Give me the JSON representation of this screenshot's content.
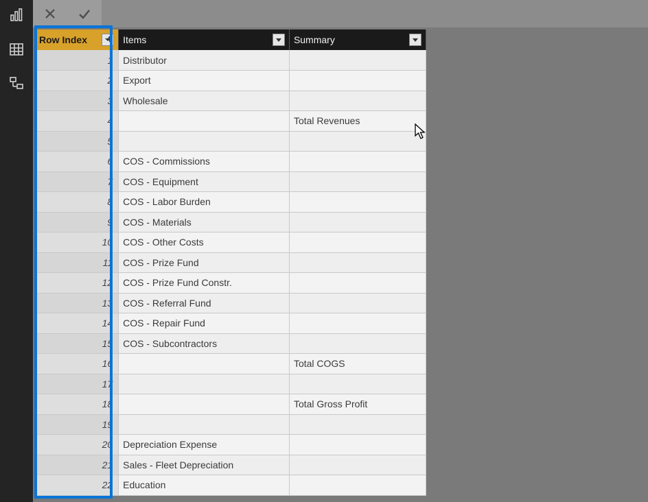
{
  "nav": {
    "report_icon": "report-view-icon",
    "data_icon": "data-view-icon",
    "model_icon": "model-view-icon"
  },
  "formulaBar": {
    "cancel": "✕",
    "accept": "✓"
  },
  "table": {
    "columns": {
      "rowIndex": "Row Index",
      "items": "Items",
      "summary": "Summary"
    },
    "rows": [
      {
        "idx": "1",
        "items": "Distributor",
        "summary": ""
      },
      {
        "idx": "2",
        "items": "Export",
        "summary": ""
      },
      {
        "idx": "3",
        "items": "Wholesale",
        "summary": ""
      },
      {
        "idx": "4",
        "items": "",
        "summary": "Total Revenues"
      },
      {
        "idx": "5",
        "items": "",
        "summary": ""
      },
      {
        "idx": "6",
        "items": "COS - Commissions",
        "summary": ""
      },
      {
        "idx": "7",
        "items": "COS - Equipment",
        "summary": ""
      },
      {
        "idx": "8",
        "items": "COS - Labor Burden",
        "summary": ""
      },
      {
        "idx": "9",
        "items": "COS - Materials",
        "summary": ""
      },
      {
        "idx": "10",
        "items": "COS - Other Costs",
        "summary": ""
      },
      {
        "idx": "11",
        "items": "COS - Prize Fund",
        "summary": ""
      },
      {
        "idx": "12",
        "items": "COS - Prize Fund Constr.",
        "summary": ""
      },
      {
        "idx": "13",
        "items": "COS - Referral Fund",
        "summary": ""
      },
      {
        "idx": "14",
        "items": "COS - Repair Fund",
        "summary": ""
      },
      {
        "idx": "15",
        "items": "COS - Subcontractors",
        "summary": ""
      },
      {
        "idx": "16",
        "items": "",
        "summary": "Total COGS"
      },
      {
        "idx": "17",
        "items": "",
        "summary": ""
      },
      {
        "idx": "18",
        "items": "",
        "summary": "Total Gross Profit"
      },
      {
        "idx": "19",
        "items": "",
        "summary": ""
      },
      {
        "idx": "20",
        "items": "Depreciation Expense",
        "summary": ""
      },
      {
        "idx": "21",
        "items": "Sales - Fleet Depreciation",
        "summary": ""
      },
      {
        "idx": "22",
        "items": "Education",
        "summary": ""
      }
    ]
  }
}
